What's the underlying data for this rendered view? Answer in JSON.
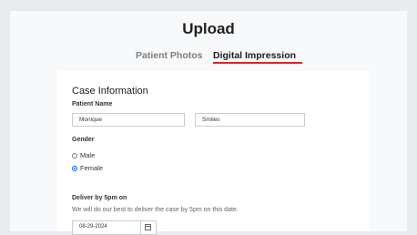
{
  "page": {
    "title": "Upload"
  },
  "tabs": [
    {
      "label": "Patient Photos",
      "active": false
    },
    {
      "label": "Digital Impression",
      "active": true
    }
  ],
  "accent_color": "#d7262b",
  "case": {
    "section_title": "Case Information",
    "patient_name_label": "Patient Name",
    "first_name": "Monique",
    "last_name": "Smiles",
    "gender_label": "Gender",
    "gender_options": [
      {
        "label": "Male",
        "selected": false
      },
      {
        "label": "Female",
        "selected": true
      }
    ],
    "deliver_label": "Deliver by 5pm on",
    "deliver_help": "We will do our best to deliver the case by 5pm on this date.",
    "deliver_date": "08-29-2024",
    "calendar_icon": "calendar-icon"
  }
}
